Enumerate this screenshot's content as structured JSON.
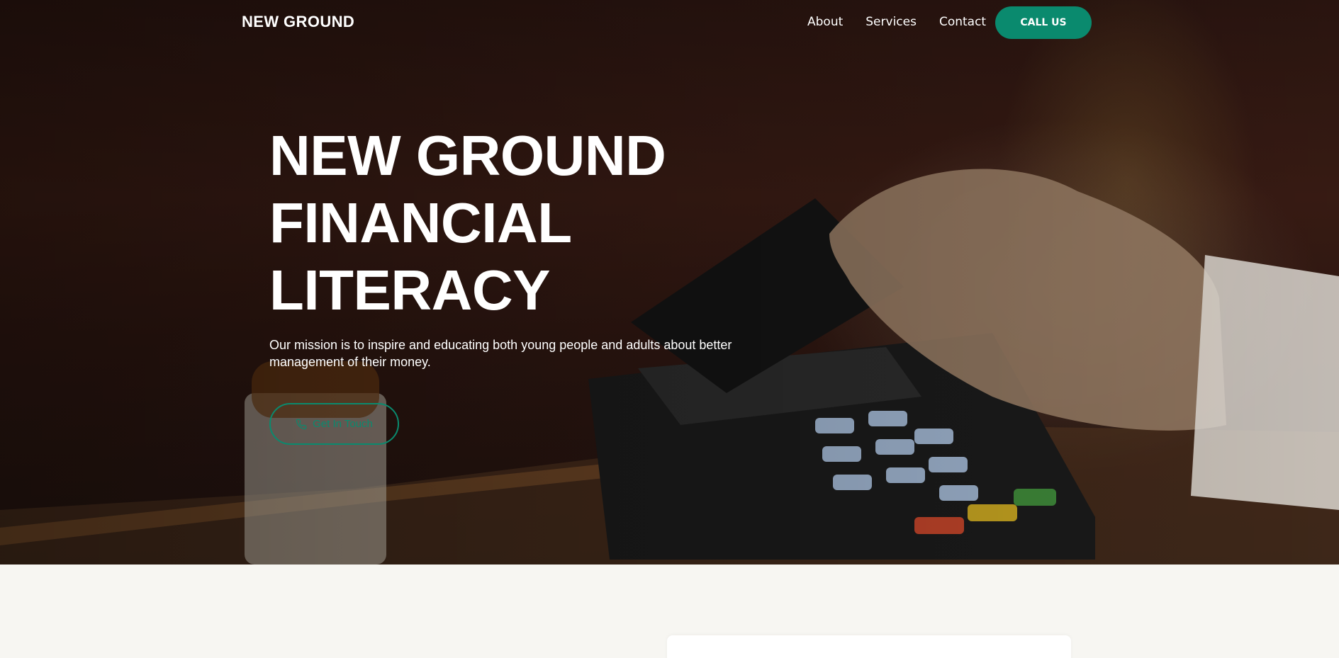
{
  "nav": {
    "logo": "NEW GROUND",
    "links": [
      {
        "label": "About"
      },
      {
        "label": "Services"
      },
      {
        "label": "Contact"
      }
    ],
    "call_button": "CALL US"
  },
  "hero": {
    "headline_lines": [
      "NEW GROUND",
      "FINANCIAL",
      "LITERACY"
    ],
    "mission": "Our mission is to inspire and educating both young people and adults about better management of their money.",
    "cta_label": "Get In Touch"
  },
  "colors": {
    "accent": "#0a8a6e",
    "text_light": "#ffffff",
    "page_bg": "#f7f6f2"
  },
  "icons": {
    "cta_icon": "phone-icon"
  }
}
